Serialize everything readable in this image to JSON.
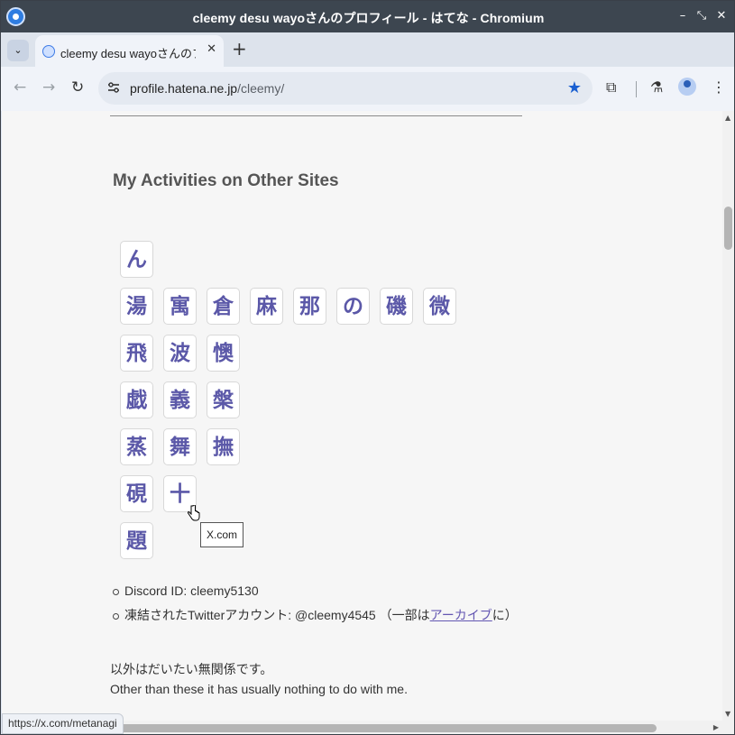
{
  "window": {
    "title": "cleemy desu wayoさんのプロフィール - はてな - Chromium",
    "minimize_glyph": "–",
    "maximize_glyph": "⤡",
    "close_glyph": "✕"
  },
  "tabs": {
    "list_glyph": "⌄",
    "active": {
      "title": "cleemy desu wayoさんのプロフ",
      "close_glyph": "✕"
    },
    "new_tab_glyph": "+"
  },
  "toolbar": {
    "back_glyph": "←",
    "forward_glyph": "→",
    "reload_glyph": "↻",
    "url_host": "profile.hatena.ne.jp",
    "url_path": "/cleemy/",
    "star_glyph": "★",
    "extensions_glyph": "⧉",
    "labs_glyph": "⚗",
    "menu_glyph": "⋮"
  },
  "page": {
    "section_heading": "My Activities on Other Sites",
    "kanji_rows": [
      [
        "ん"
      ],
      [
        "湯",
        "寓",
        "倉",
        "麻",
        "那",
        "の",
        "磯",
        "微"
      ],
      [
        "飛",
        "波",
        "懊"
      ],
      [
        "戯",
        "義",
        "槃"
      ],
      [
        "蒸",
        "舞",
        "撫"
      ],
      [
        "硯",
        "十"
      ],
      [
        "題"
      ]
    ],
    "tooltip": "X.com",
    "bullets": {
      "discord": "Discord ID: cleemy5130",
      "twitter_prefix": "凍結されたTwitterアカウント: @cleemy4545 （一部は",
      "twitter_link": "アーカイブ",
      "twitter_suffix": "に）"
    },
    "para_ja": "以外はだいたい無関係です。",
    "para_en": "Other than these it has usually nothing to do with me."
  },
  "statusbar": {
    "url": "https://x.com/metanagi"
  },
  "colors": {
    "accent": "#1a5fd1",
    "kanji": "#5b58a8",
    "link": "#6457b2"
  },
  "icons": [
    "chromium-logo-icon",
    "tab-list-icon",
    "favicon-icon",
    "close-icon",
    "back-icon",
    "forward-icon",
    "reload-icon",
    "site-info-icon",
    "bookmark-star-icon",
    "extensions-icon",
    "labs-icon",
    "profile-icon",
    "menu-icon",
    "hand-cursor-icon"
  ]
}
